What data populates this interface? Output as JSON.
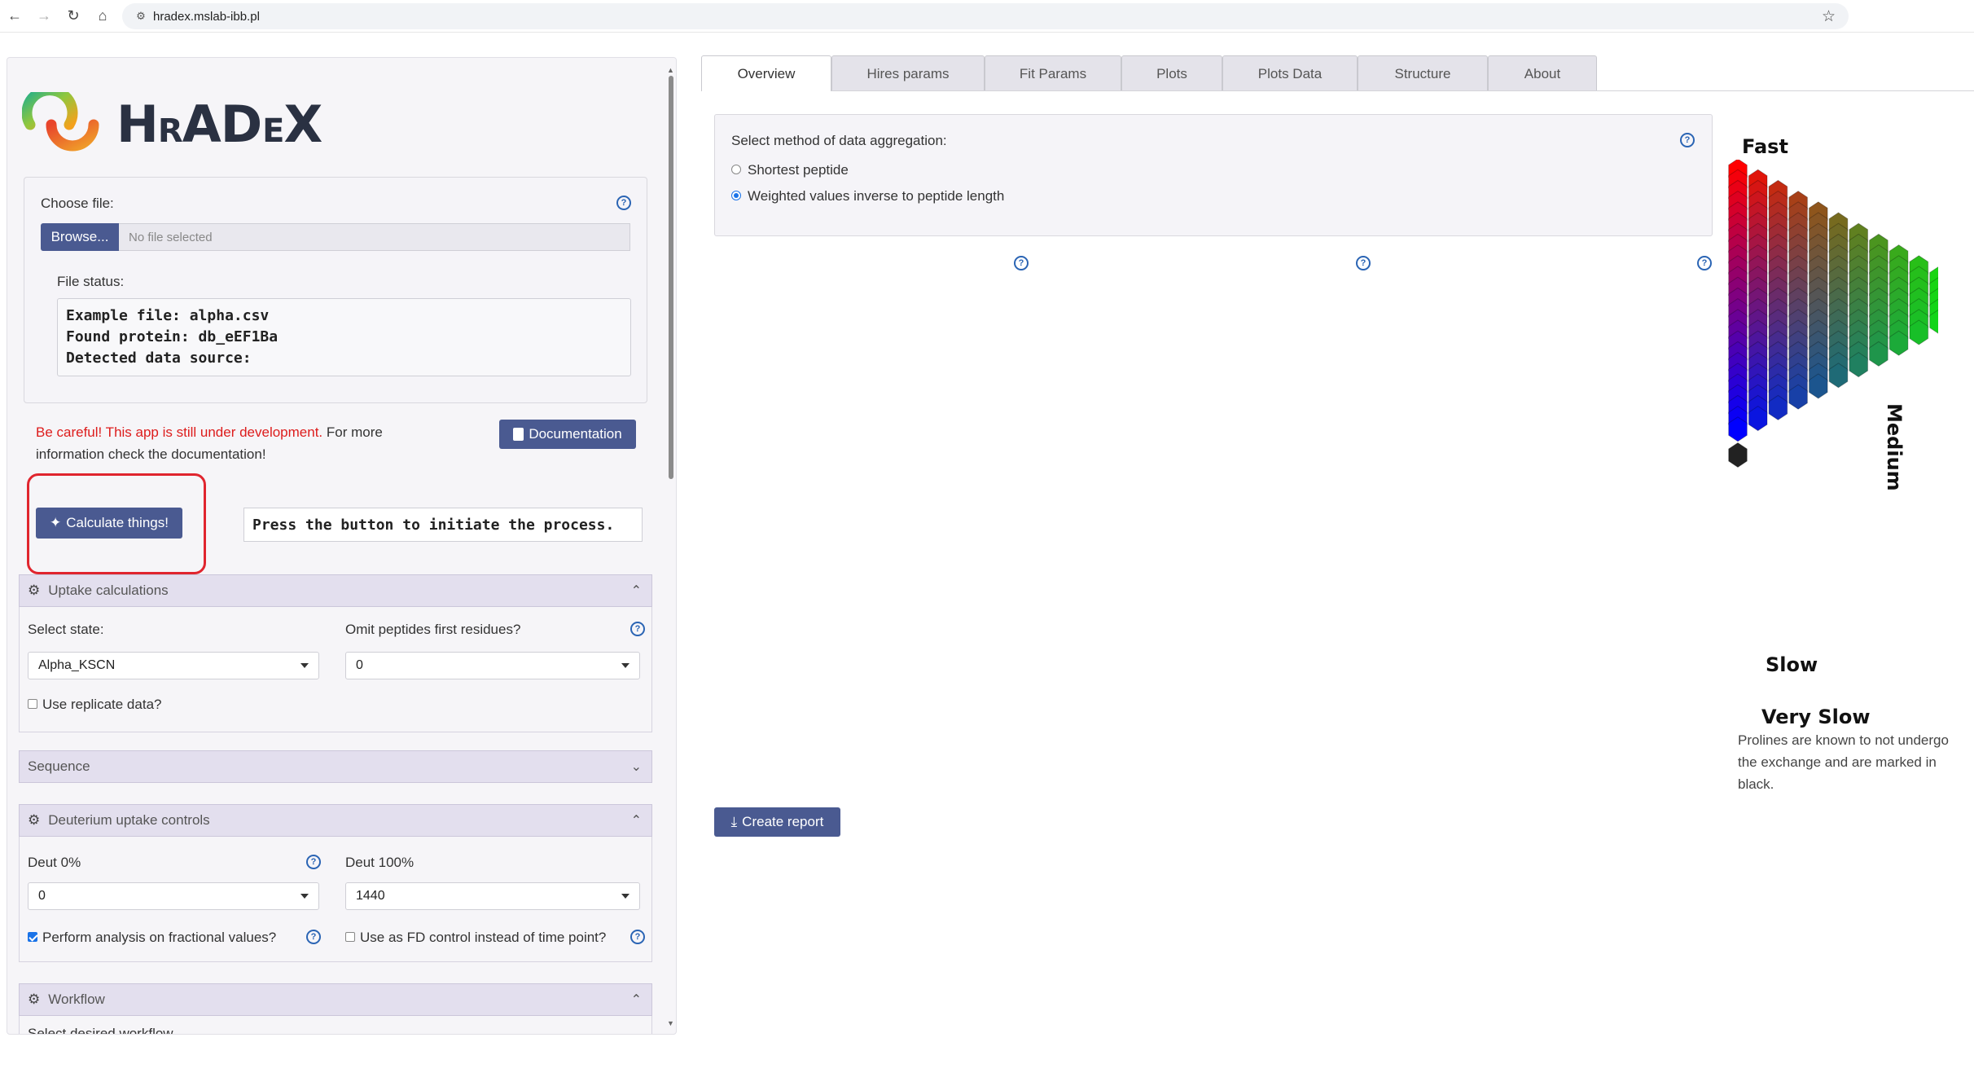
{
  "browser": {
    "url": "hradex.mslab-ibb.pl",
    "icons": [
      "back-icon",
      "forward-icon",
      "reload-icon",
      "home-icon",
      "site-info-icon",
      "bookmark-star-icon"
    ]
  },
  "app": {
    "logo_text": "HRADEX"
  },
  "file_input": {
    "label": "Choose file:",
    "browse_label": "Browse...",
    "file_placeholder": "No file selected",
    "status_label": "File status:",
    "status_lines": [
      "Example file: alpha.csv",
      "Found protein: db_eEF1Ba",
      "Detected data source:"
    ]
  },
  "warning": {
    "red_text": "Be careful! This app is still under development.",
    "rest_text": " For more information check the documentation!"
  },
  "buttons": {
    "documentation": "Documentation",
    "calculate": "Calculate things!",
    "create_report": "Create report"
  },
  "process_status": "Press the button to initiate the process.",
  "uptake": {
    "title": "Uptake calculations",
    "state_label": "Select state:",
    "state_value": "Alpha_KSCN",
    "omit_label": "Omit peptides first residues?",
    "omit_value": "0",
    "replicate_label": "Use replicate data?"
  },
  "sequence": {
    "title": "Sequence"
  },
  "deut": {
    "title": "Deuterium uptake controls",
    "deut0_label": "Deut 0%",
    "deut0_value": "0",
    "deut100_label": "Deut 100%",
    "deut100_value": "1440",
    "fractional_label": "Perform analysis on fractional values?",
    "fd_label": "Use as FD control instead of time point?"
  },
  "workflow": {
    "title": "Workflow",
    "partial_label": "Select desired workflow"
  },
  "tabs": [
    "Overview",
    "Hires params",
    "Fit Params",
    "Plots",
    "Plots Data",
    "Structure",
    "About"
  ],
  "aggregation": {
    "label": "Select method of data aggregation:",
    "option1": "Shortest peptide",
    "option2": "Weighted values inverse to peptide length",
    "selected": "Weighted values inverse to peptide length"
  },
  "legend": {
    "fast": "Fast",
    "medium": "Medium",
    "slow": "Slow",
    "very_slow": "Very Slow",
    "note": "Prolines are known to not undergo the exchange and are marked in black.",
    "colors": {
      "fast": "#ff0000",
      "medium": "#00ff00",
      "slow": "#0000ff",
      "very_slow": "#222222"
    }
  },
  "colors": {
    "primary_button": "#4a5a91",
    "section_header": "#e3dfee",
    "warning_red": "#dd1c1c",
    "highlight_red": "#e0252e"
  }
}
